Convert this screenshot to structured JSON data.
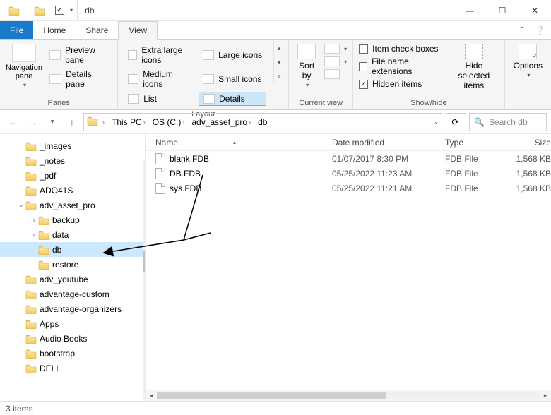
{
  "window": {
    "title": "db"
  },
  "tabs": {
    "file": "File",
    "home": "Home",
    "share": "Share",
    "view": "View"
  },
  "ribbon": {
    "panes": {
      "nav_label": "Navigation\npane",
      "preview": "Preview pane",
      "details": "Details pane",
      "group": "Panes"
    },
    "layout": {
      "xl": "Extra large icons",
      "large": "Large icons",
      "medium": "Medium icons",
      "small": "Small icons",
      "list": "List",
      "details": "Details",
      "group": "Layout"
    },
    "currentview": {
      "sort": "Sort\nby",
      "group": "Current view"
    },
    "showhide": {
      "item_check": "Item check boxes",
      "ext": "File name extensions",
      "hidden": "Hidden items",
      "hide_sel": "Hide selected\nitems",
      "group": "Show/hide"
    },
    "options": {
      "label": "Options"
    }
  },
  "breadcrumb": {
    "pc": "This PC",
    "drive": "OS (C:)",
    "p1": "adv_asset_pro",
    "p2": "db"
  },
  "search": {
    "placeholder": "Search db"
  },
  "tree": {
    "items": [
      {
        "name": "_images",
        "indent": 1
      },
      {
        "name": "_notes",
        "indent": 1
      },
      {
        "name": "_pdf",
        "indent": 1
      },
      {
        "name": "ADO41S",
        "indent": 1
      },
      {
        "name": "adv_asset_pro",
        "indent": 1,
        "expanded": true
      },
      {
        "name": "backup",
        "indent": 2,
        "child": true
      },
      {
        "name": "data",
        "indent": 2,
        "child": true
      },
      {
        "name": "db",
        "indent": 2,
        "selected": true
      },
      {
        "name": "restore",
        "indent": 2
      },
      {
        "name": "adv_youtube",
        "indent": 1
      },
      {
        "name": "advantage-custom",
        "indent": 1
      },
      {
        "name": "advantage-organizers",
        "indent": 1
      },
      {
        "name": "Apps",
        "indent": 1
      },
      {
        "name": "Audio Books",
        "indent": 1
      },
      {
        "name": "bootstrap",
        "indent": 1
      },
      {
        "name": "DELL",
        "indent": 1
      }
    ]
  },
  "columns": {
    "name": "Name",
    "date": "Date modified",
    "type": "Type",
    "size": "Size"
  },
  "files": [
    {
      "name": "blank.FDB",
      "date": "01/07/2017 8:30 PM",
      "type": "FDB File",
      "size": "1,568 KB"
    },
    {
      "name": "DB.FDB",
      "date": "05/25/2022 11:23 AM",
      "type": "FDB File",
      "size": "1,568 KB"
    },
    {
      "name": "sys.FDB",
      "date": "05/25/2022 11:21 AM",
      "type": "FDB File",
      "size": "1,568 KB"
    }
  ],
  "status": {
    "text": "3 items"
  }
}
